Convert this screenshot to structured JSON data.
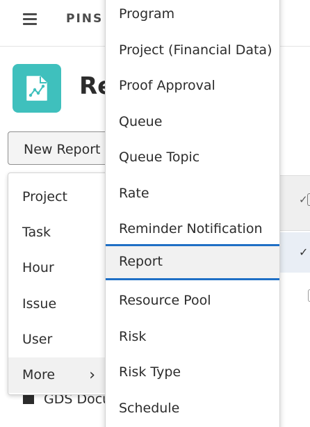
{
  "topbar": {
    "menu_icon": "hamburger-icon",
    "app_label": "PINS"
  },
  "header": {
    "title": "Re",
    "tile_icon": "report-document-chart-icon",
    "tile_color": "#3fc0bd"
  },
  "new_report_button": {
    "label": "New Report"
  },
  "background_list": {
    "doc_label": "GDS Docu"
  },
  "menu_primary": {
    "items": [
      {
        "label": "Project"
      },
      {
        "label": "Task"
      },
      {
        "label": "Hour"
      },
      {
        "label": "Issue"
      },
      {
        "label": "User"
      },
      {
        "label": "More",
        "has_submenu": true,
        "chevron": "chevron-right-icon"
      }
    ]
  },
  "menu_secondary": {
    "selected_index": 7,
    "accent_color": "#1f6fc5",
    "items": [
      {
        "label": "Program"
      },
      {
        "label": "Project (Financial Data)"
      },
      {
        "label": "Proof Approval"
      },
      {
        "label": "Queue"
      },
      {
        "label": "Queue Topic"
      },
      {
        "label": "Rate"
      },
      {
        "label": "Reminder Notification"
      },
      {
        "label": "Report"
      },
      {
        "label": "Resource Pool"
      },
      {
        "label": "Risk"
      },
      {
        "label": "Risk Type"
      },
      {
        "label": "Schedule"
      }
    ]
  }
}
